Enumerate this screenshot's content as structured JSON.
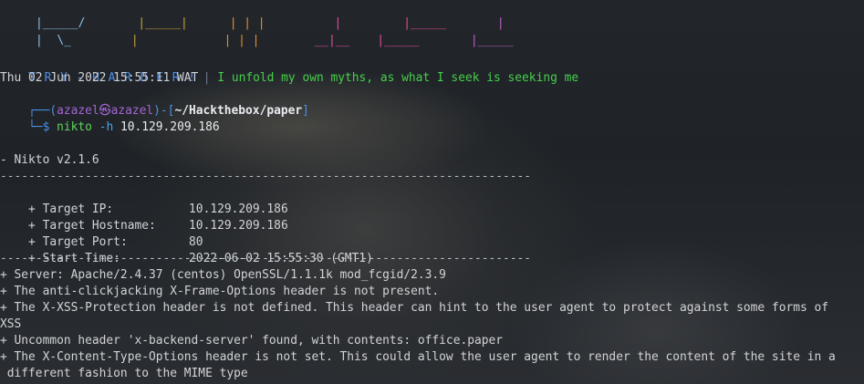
{
  "ascii_art": {
    "row1": [
      "|_____/",
      "|_____|",
      "| | |",
      "|",
      "|_____",
      "|"
    ],
    "row2": [
      "|  \\_",
      "|",
      "| | |",
      "__|__",
      "|_____",
      "|_____"
    ]
  },
  "banner": {
    "tag": "T R Y - H A R D E R !",
    "separator": "|",
    "motto": "I unfold my own myths, as what I seek is seeking me"
  },
  "date_line": "Thu 02 Jun 2022 15:55:11 WAT",
  "prompt": {
    "corner_top": "┌──",
    "open_paren": "(",
    "user_host": "azazel㉿azazel",
    "close_paren": ")",
    "dash_bracket": "-[",
    "cwd": "~/Hackthebox/paper",
    "close_bracket": "]",
    "corner_bottom": "└─",
    "dollar": "$",
    "command": "nikto",
    "flag": "-h",
    "argument": "10.129.209.186"
  },
  "output": {
    "version": "- Nikto v2.1.6",
    "divider": "---------------------------------------------------------------------------",
    "target_ip": {
      "label": "+ Target IP:",
      "value": "10.129.209.186"
    },
    "target_hostname": {
      "label": "+ Target Hostname:",
      "value": "10.129.209.186"
    },
    "target_port": {
      "label": "+ Target Port:",
      "value": "80"
    },
    "start_time": {
      "label": "+ Start Time:",
      "value": "2022-06-02 15:55:30 (GMT1)"
    },
    "findings": [
      "+ Server: Apache/2.4.37 (centos) OpenSSL/1.1.1k mod_fcgid/2.3.9",
      "+ The anti-clickjacking X-Frame-Options header is not present.",
      "+ The X-XSS-Protection header is not defined. This header can hint to the user agent to protect against some forms of",
      "XSS",
      "+ Uncommon header 'x-backend-server' found, with contents: office.paper",
      "+ The X-Content-Type-Options header is not set. This could allow the user agent to render the content of the site in a",
      " different fashion to the MIME type"
    ]
  },
  "colors": {
    "background": "#1d2024",
    "text": "#d2d4d8",
    "banner_tag": "#4f8fe6",
    "motto": "#47cf4a",
    "user_host": "#a564d6",
    "command": "#5fd35c"
  }
}
